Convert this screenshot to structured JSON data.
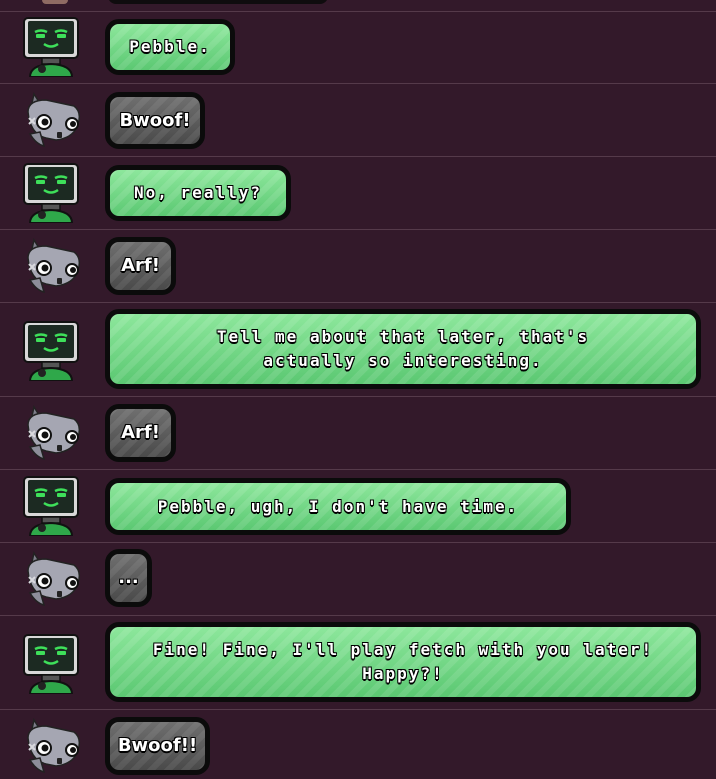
{
  "messages": [
    {
      "speaker": "robot",
      "text": "Pebble."
    },
    {
      "speaker": "dog",
      "text": "Bwoof!"
    },
    {
      "speaker": "robot",
      "text": "No, really?"
    },
    {
      "speaker": "dog",
      "text": "Arf!"
    },
    {
      "speaker": "robot",
      "text": "Tell me about that later, that's actually so interesting."
    },
    {
      "speaker": "dog",
      "text": "Arf!"
    },
    {
      "speaker": "robot",
      "text": "Pebble, ugh, I don't have time."
    },
    {
      "speaker": "dog",
      "text": "..."
    },
    {
      "speaker": "robot",
      "text": "Fine! Fine, I'll play fetch with you later! Happy?!"
    },
    {
      "speaker": "dog",
      "text": "Bwoof!!"
    }
  ],
  "avatars": {
    "robot": "robot-monitor-icon",
    "dog": "gray-dog-icon"
  },
  "colors": {
    "background": "#33192a",
    "divider": "#553a4a",
    "robot_bubble": "#6fd685",
    "dog_bubble": "#5b5b5b",
    "bubble_border": "#0b0b0b",
    "robot_screen": "#1c2a22",
    "robot_face": "#3ee05a"
  }
}
